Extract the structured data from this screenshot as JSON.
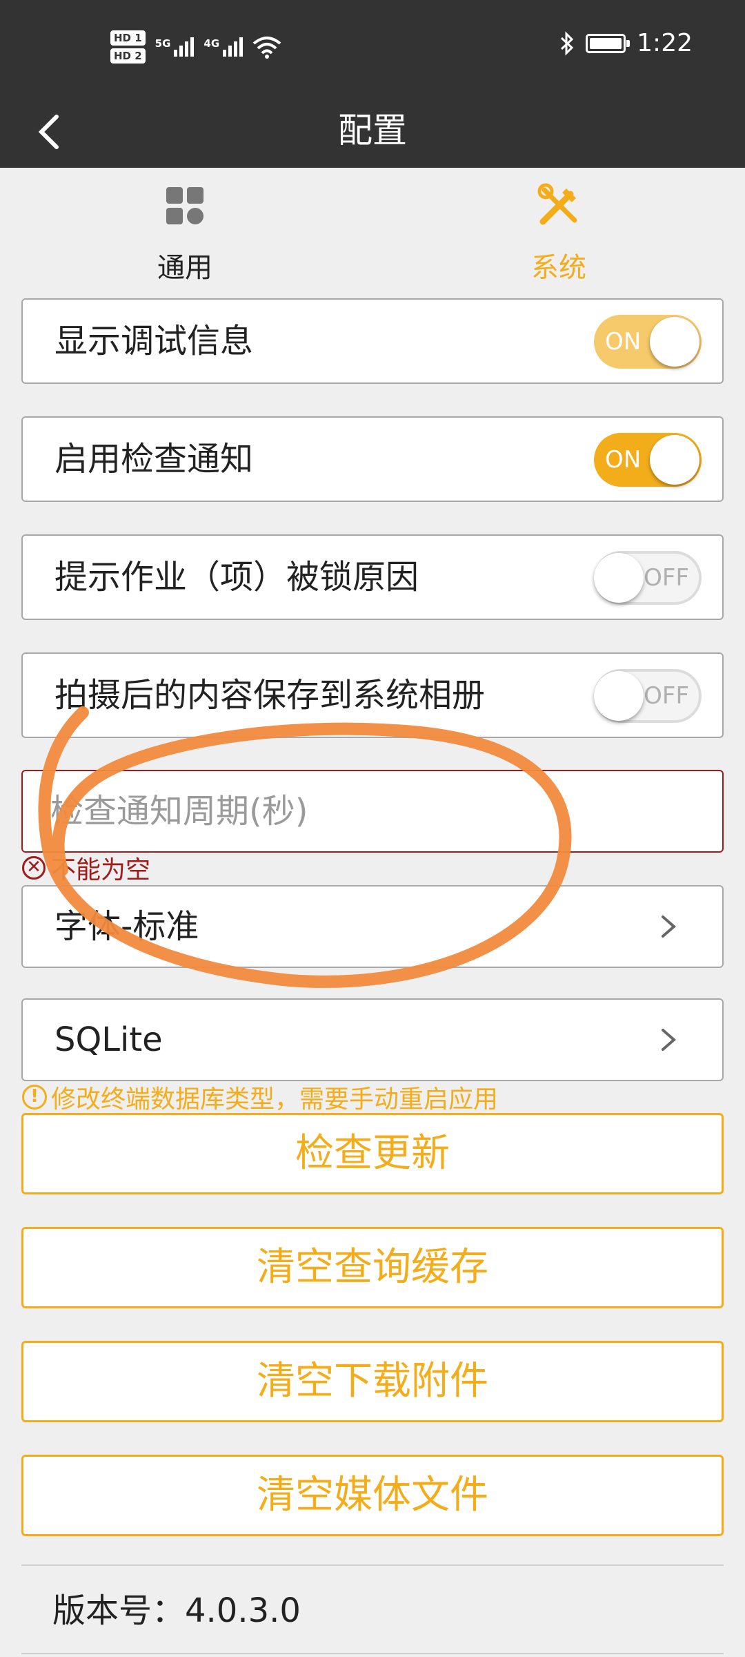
{
  "status_bar": {
    "hd1": "HD 1",
    "hd2": "HD 2",
    "net1": "5G",
    "net2": "4G",
    "time": "1:22"
  },
  "title_bar": {
    "title": "配置"
  },
  "tabs": [
    {
      "label": "通用",
      "icon": "grid-icon",
      "active": false
    },
    {
      "label": "系统",
      "icon": "tools-icon",
      "active": true
    }
  ],
  "toggles": [
    {
      "label": "显示调试信息",
      "state": "ON",
      "on": true
    },
    {
      "label": "启用检查通知",
      "state": "ON",
      "on": true
    },
    {
      "label": "提示作业（项）被锁原因",
      "state": "OFF",
      "on": false
    },
    {
      "label": "拍摄后的内容保存到系统相册",
      "state": "OFF",
      "on": false
    }
  ],
  "interval_input": {
    "placeholder": "检查通知周期(秒)",
    "value": "",
    "error": "不能为空"
  },
  "nav_items": [
    {
      "label": "字体-标准"
    },
    {
      "label": "SQLite"
    }
  ],
  "db_warning": "修改终端数据库类型，需要手动重启应用",
  "buttons": {
    "check_update": "检查更新",
    "clear_query_cache": "清空查询缓存",
    "clear_downloads": "清空下载附件",
    "clear_media": "清空媒体文件"
  },
  "version": "版本号：4.0.3.0",
  "colors": {
    "accent": "#f3ad1b",
    "header": "#333333",
    "error": "#a01b1b",
    "annotation": "#f08a3c"
  }
}
